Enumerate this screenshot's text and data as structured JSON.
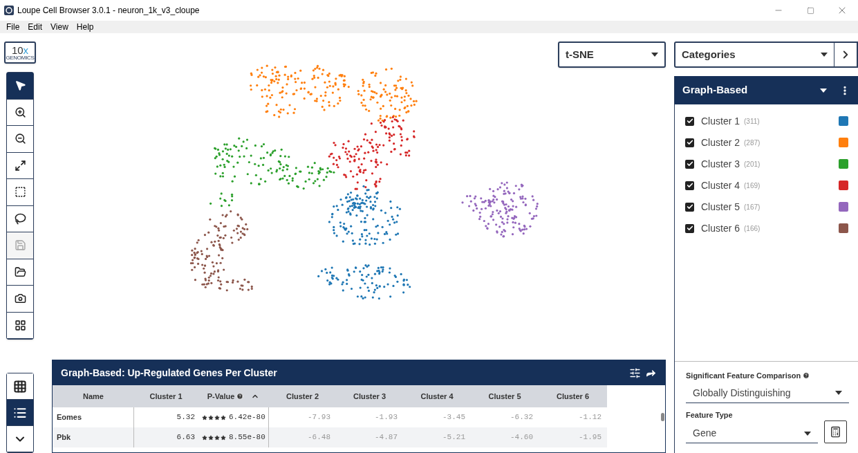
{
  "window": {
    "title": "Loupe Cell Browser 3.0.1 - neuron_1k_v3_cloupe"
  },
  "menu": [
    "File",
    "Edit",
    "View",
    "Help"
  ],
  "logo": {
    "main": "10",
    "mark": "x",
    "sub": "GENOMICS"
  },
  "tools": [
    {
      "kind": "pointer",
      "selected": true,
      "disabled": false
    },
    {
      "kind": "zoom-in",
      "selected": false,
      "disabled": false
    },
    {
      "kind": "zoom-out",
      "selected": false,
      "disabled": false
    },
    {
      "kind": "fit",
      "selected": false,
      "disabled": false
    },
    {
      "kind": "box-select",
      "selected": false,
      "disabled": false
    },
    {
      "kind": "lasso",
      "selected": false,
      "disabled": false
    },
    {
      "kind": "save",
      "selected": false,
      "disabled": true
    },
    {
      "kind": "open",
      "selected": false,
      "disabled": false
    },
    {
      "kind": "camera",
      "selected": false,
      "disabled": false
    },
    {
      "kind": "layout",
      "selected": false,
      "disabled": false
    }
  ],
  "views": [
    {
      "kind": "grid",
      "selected": false
    },
    {
      "kind": "list",
      "selected": true
    },
    {
      "kind": "collapse",
      "selected": false
    }
  ],
  "projection": {
    "value": "t-SNE"
  },
  "category_select": {
    "value": "Categories"
  },
  "legend": {
    "title": "Graph-Based",
    "items": [
      {
        "label": "Cluster 1",
        "count": "(311)",
        "checked": true,
        "color": "#1f77b4"
      },
      {
        "label": "Cluster 2",
        "count": "(287)",
        "checked": true,
        "color": "#ff7f0e"
      },
      {
        "label": "Cluster 3",
        "count": "(201)",
        "checked": true,
        "color": "#2ca02c"
      },
      {
        "label": "Cluster 4",
        "count": "(169)",
        "checked": true,
        "color": "#d62728"
      },
      {
        "label": "Cluster 5",
        "count": "(167)",
        "checked": true,
        "color": "#9467bd"
      },
      {
        "label": "Cluster 6",
        "count": "(166)",
        "checked": true,
        "color": "#8c564b"
      }
    ]
  },
  "comparison": {
    "label": "Significant Feature Comparison",
    "value": "Globally Distinguishing"
  },
  "feature_type": {
    "label": "Feature Type",
    "value": "Gene"
  },
  "table": {
    "title": "Graph-Based: Up-Regulated Genes Per Cluster",
    "columns": [
      "Name",
      "Cluster 1",
      "P-Value",
      "Cluster 2",
      "Cluster 3",
      "Cluster 4",
      "Cluster 5",
      "Cluster 6"
    ],
    "rows": [
      {
        "name": "Eomes",
        "cluster_1": "5.32",
        "stars": 4,
        "p_value": "6.42e-80",
        "others": [
          "-7.93",
          "-1.93",
          "-3.45",
          "-6.32",
          "-1.12"
        ]
      },
      {
        "name": "Pbk",
        "cluster_1": "6.63",
        "stars": 4,
        "p_value": "8.55e-80",
        "others": [
          "-6.48",
          "-4.87",
          "-5.21",
          "-4.60",
          "-1.95"
        ]
      }
    ]
  }
}
